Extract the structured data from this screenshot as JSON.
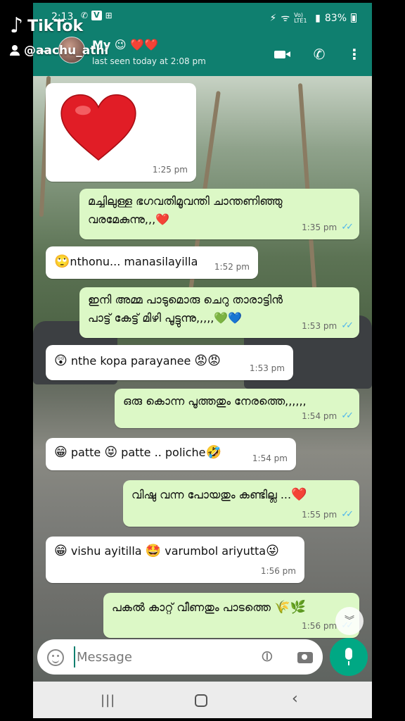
{
  "status_bar": {
    "time": "2:13",
    "icons": [
      "whatsapp-notif-icon",
      "v-notif-icon",
      "grid-notif-icon"
    ],
    "battery": "83%",
    "network": "Vo) LTE1"
  },
  "header": {
    "contact_name": "My 😉 ❤️❤️",
    "last_seen": "last seen today at 2:08 pm"
  },
  "tiktok": {
    "brand": "TikTok",
    "username": "@aachu_athi"
  },
  "messages": [
    {
      "dir": "in",
      "type": "sticker",
      "text": "❤️",
      "time": "1:25 pm"
    },
    {
      "dir": "out",
      "text_line1": "മച്ചിലുള്ള ഭഗവതിമൂവന്തി ചാന്തണിഞ്ഞു",
      "text_line2": "വരമേകുന്നു,,,❤️",
      "time": "1:35 pm",
      "read": true
    },
    {
      "dir": "in",
      "emoji": "🙄",
      "text": "nthonu... manasilayilla",
      "time": "1:52 pm"
    },
    {
      "dir": "out",
      "text_line1": "ഇനി അമ്മ പാടുമൊരു ചെറു താരാട്ടിൻ",
      "text_line2": "പാട്ട് കേട്ട് മിഴി പൂട്ടുന്നു,,,,,💚💙",
      "time": "1:53 pm",
      "read": true
    },
    {
      "dir": "in",
      "emoji": "😲",
      "text": "nthe kopa parayanee",
      "emoji_after": "😡😡",
      "time": "1:53 pm"
    },
    {
      "dir": "out",
      "text": "ഒരു കൊന്ന പൂത്തതും നേരത്തെ,,,,,,",
      "time": "1:54 pm",
      "read": true
    },
    {
      "dir": "in",
      "emoji": "😁",
      "text_a": "patte",
      "emoji_mid": "😝",
      "text_b": "patte ..  poliche",
      "emoji_after": "🤣",
      "time": "1:54 pm"
    },
    {
      "dir": "out",
      "text": "വിഷു വന്ന പോയതും കണ്ടില്ല ...",
      "emoji_after": "❤️",
      "time": "1:55 pm",
      "read": true
    },
    {
      "dir": "in",
      "emoji": "😁",
      "text_a": "vishu ayitilla",
      "emoji_mid": "🤩",
      "text_b": "varumbol ariyutta",
      "emoji_after": "😜",
      "time": "1:56 pm"
    },
    {
      "dir": "out",
      "text": "പകൽ കാറ്റ് വീണതും പാടത്തെ",
      "emoji_after": "🌾🌿",
      "time": "1:56 pm",
      "read": true
    }
  ],
  "input": {
    "placeholder": "Message"
  },
  "colors": {
    "header": "#0f7f6f",
    "incoming": "#ffffff",
    "outgoing": "#dcf8c6",
    "accent": "#00a884",
    "tick_read": "#4fb6ec"
  }
}
